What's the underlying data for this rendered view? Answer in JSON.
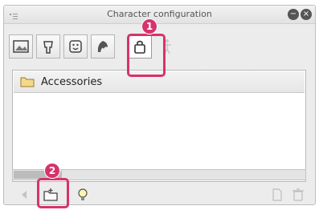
{
  "window": {
    "title": "Character configuration",
    "title_buttons": [
      "collapse-button",
      "close-button"
    ]
  },
  "toolbar": {
    "tools": [
      {
        "name": "tool-scene"
      },
      {
        "name": "tool-body"
      },
      {
        "name": "tool-face"
      },
      {
        "name": "tool-hair"
      },
      {
        "name": "tool-accessories",
        "selected": true
      },
      {
        "name": "tool-pose",
        "disabled": true
      }
    ]
  },
  "list": {
    "items": [
      {
        "label": "Accessories",
        "icon": "folder-icon"
      }
    ]
  },
  "annotations": {
    "badge_1": "1",
    "badge_2": "2"
  },
  "bottombar": {
    "icons": [
      "arrow-left-icon",
      "new-folder-icon",
      "lightbulb-icon",
      "page-icon",
      "trash-icon"
    ]
  },
  "colors": {
    "accent": "#d6336c",
    "panel": "#ececec"
  }
}
